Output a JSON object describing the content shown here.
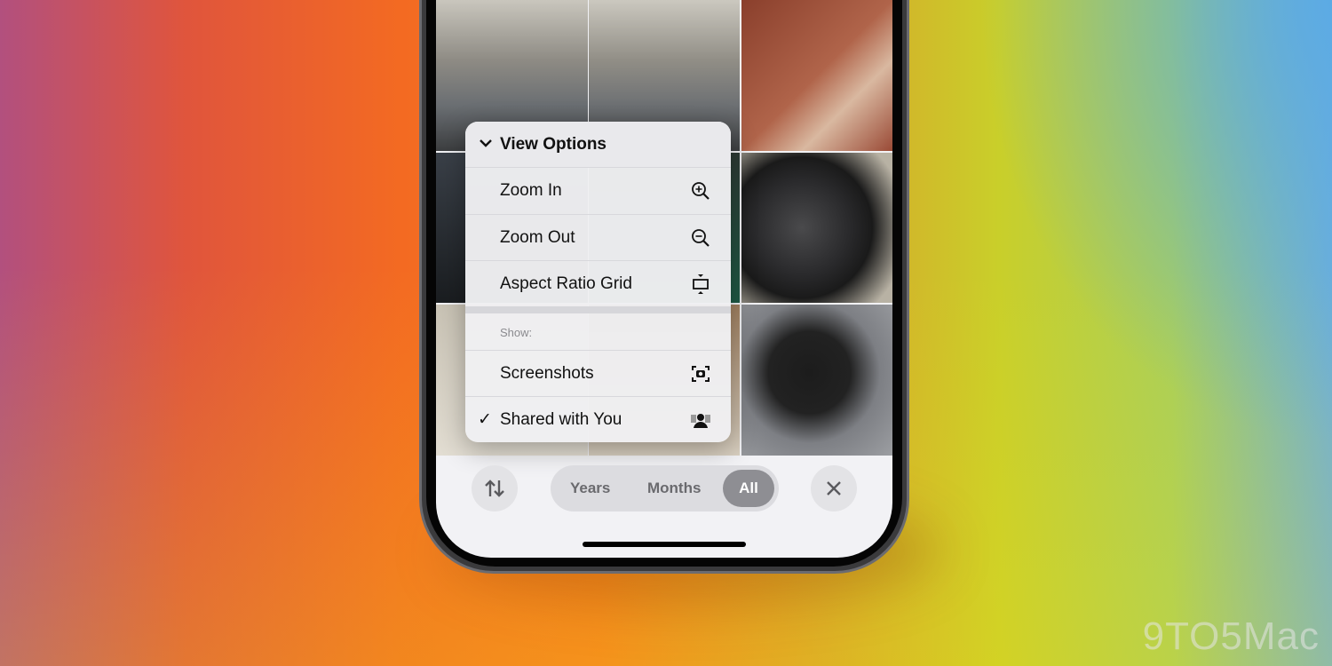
{
  "menu": {
    "title": "View Options",
    "items": [
      {
        "label": "Zoom In",
        "icon": "zoom-in-icon"
      },
      {
        "label": "Zoom Out",
        "icon": "zoom-out-icon"
      },
      {
        "label": "Aspect Ratio Grid",
        "icon": "aspect-ratio-icon"
      }
    ],
    "section_label": "Show:",
    "show_items": [
      {
        "label": "Screenshots",
        "icon": "screenshot-icon",
        "checked": false
      },
      {
        "label": "Shared with You",
        "icon": "shared-with-you-icon",
        "checked": true
      }
    ],
    "check_mark": "✓"
  },
  "toolbar": {
    "segments": [
      "Years",
      "Months",
      "All"
    ],
    "selected": "All",
    "sort_icon": "sort-arrows-icon",
    "close_icon": "close-icon"
  },
  "watermark": "9TO5Mac"
}
